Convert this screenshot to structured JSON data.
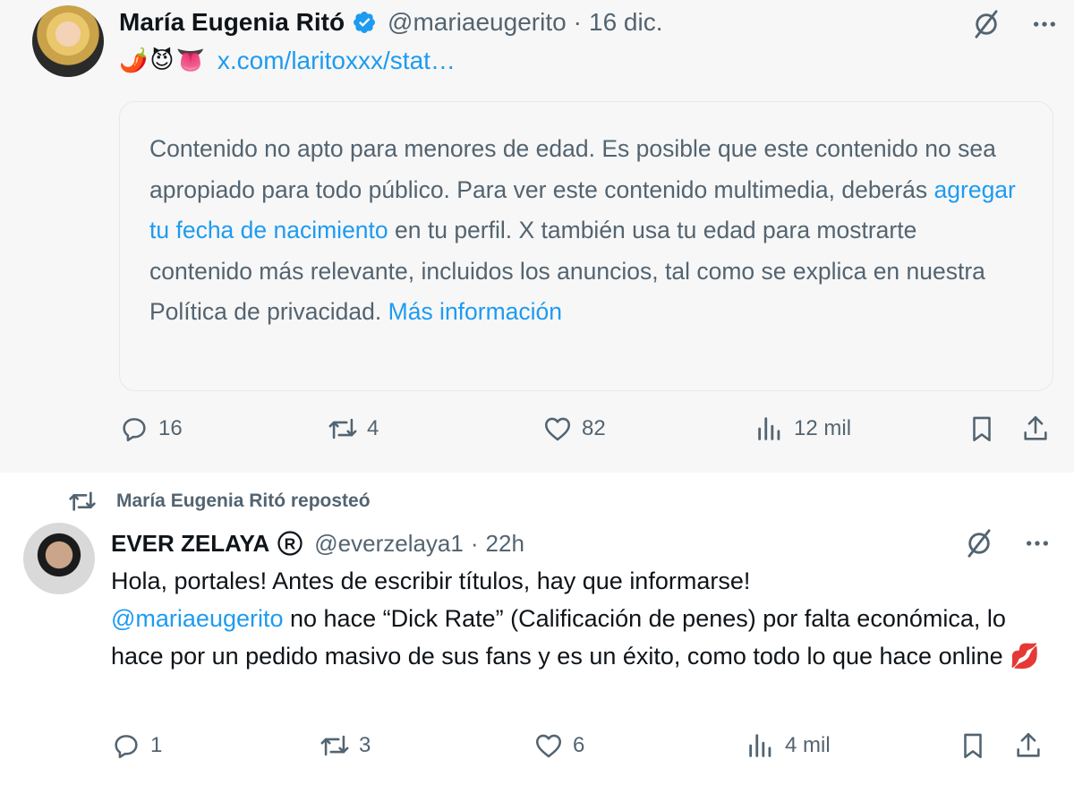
{
  "tweet1": {
    "display_name": "María Eugenia Ritó",
    "handle": "@mariaeugerito",
    "separator": "·",
    "time": "16 dic.",
    "emojis": [
      "🌶️",
      "😈",
      "👅"
    ],
    "link_text": "x.com/laritoxxx/stat…",
    "warning": {
      "text_before": "Contenido no apto para menores de edad. Es posible que este contenido no sea apropiado para todo público. Para ver este contenido multimedia, deberás ",
      "link1": "agregar tu fecha de nacimiento",
      "text_middle": " en tu perfil. X también usa tu edad para mostrarte contenido más relevante, incluidos los anuncios, tal como se explica en nuestra Política de privacidad. ",
      "link2": "Más información"
    },
    "actions": {
      "replies": "16",
      "reposts": "4",
      "likes": "82",
      "views": "12 mil"
    }
  },
  "tweet2": {
    "repost_by": "María Eugenia Ritó reposteó",
    "display_name": "EVER ZELAYA",
    "handle": "@everzelaya1",
    "separator": "·",
    "time": "22h",
    "text_line1": "Hola, portales! Antes de escribir títulos, hay que informarse!",
    "mention": "@mariaeugerito",
    "text_rest": " no hace “Dick Rate” (Calificación de penes) por falta económica, lo hace por un pedido masivo de sus fans y es un éxito, como todo lo que hace online ",
    "end_emoji": "💋",
    "actions": {
      "replies": "1",
      "reposts": "3",
      "likes": "6",
      "views": "4 mil"
    }
  },
  "colors": {
    "accent": "#1d9bf0",
    "secondary_text": "#536471",
    "primary_text": "#0f1419"
  }
}
